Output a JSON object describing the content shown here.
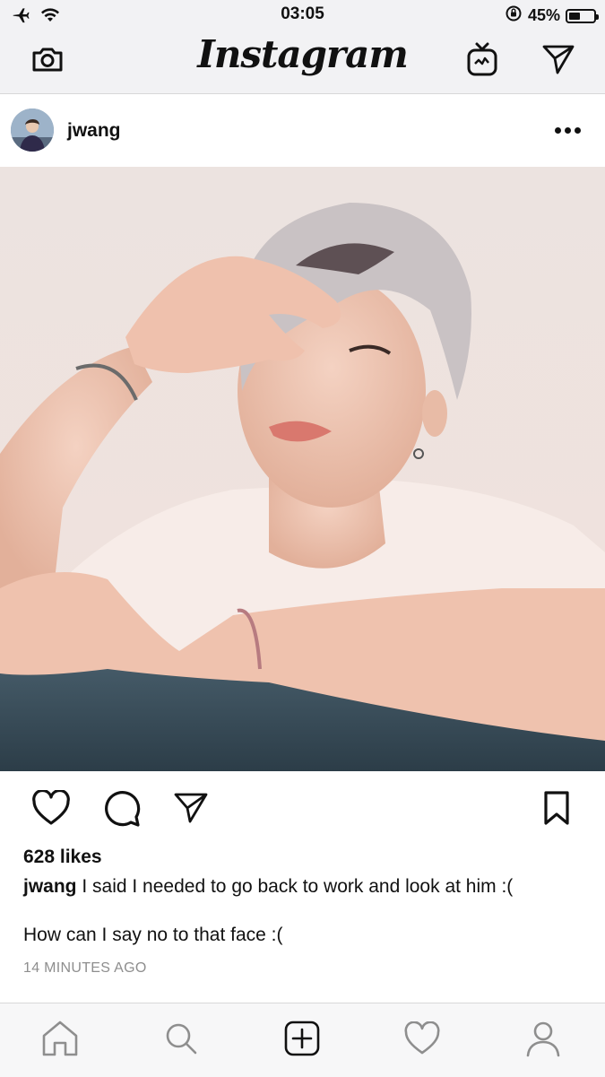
{
  "status_bar": {
    "time": "03:05",
    "battery_percent_label": "45%",
    "battery_level": 0.45,
    "icons": [
      "airplane-icon",
      "wifi-icon",
      "orientation-lock-icon",
      "battery-icon"
    ]
  },
  "nav": {
    "title": "Instagram",
    "icons": [
      "camera-icon",
      "igtv-icon",
      "direct-message-icon"
    ]
  },
  "post": {
    "username": "jwang",
    "likes": "628 likes",
    "caption_user": "jwang",
    "caption_text": "I said I needed to go back to work and look at him :(",
    "caption_second_line": "How can I say no to that face :(",
    "time_ago": "14 MINUTES AGO"
  },
  "actions": {
    "icons": [
      "heart-icon",
      "comment-icon",
      "share-icon",
      "bookmark-icon"
    ]
  },
  "tab_bar": {
    "icons": [
      "home-icon",
      "search-icon",
      "new-post-icon",
      "activity-heart-icon",
      "profile-icon"
    ]
  }
}
